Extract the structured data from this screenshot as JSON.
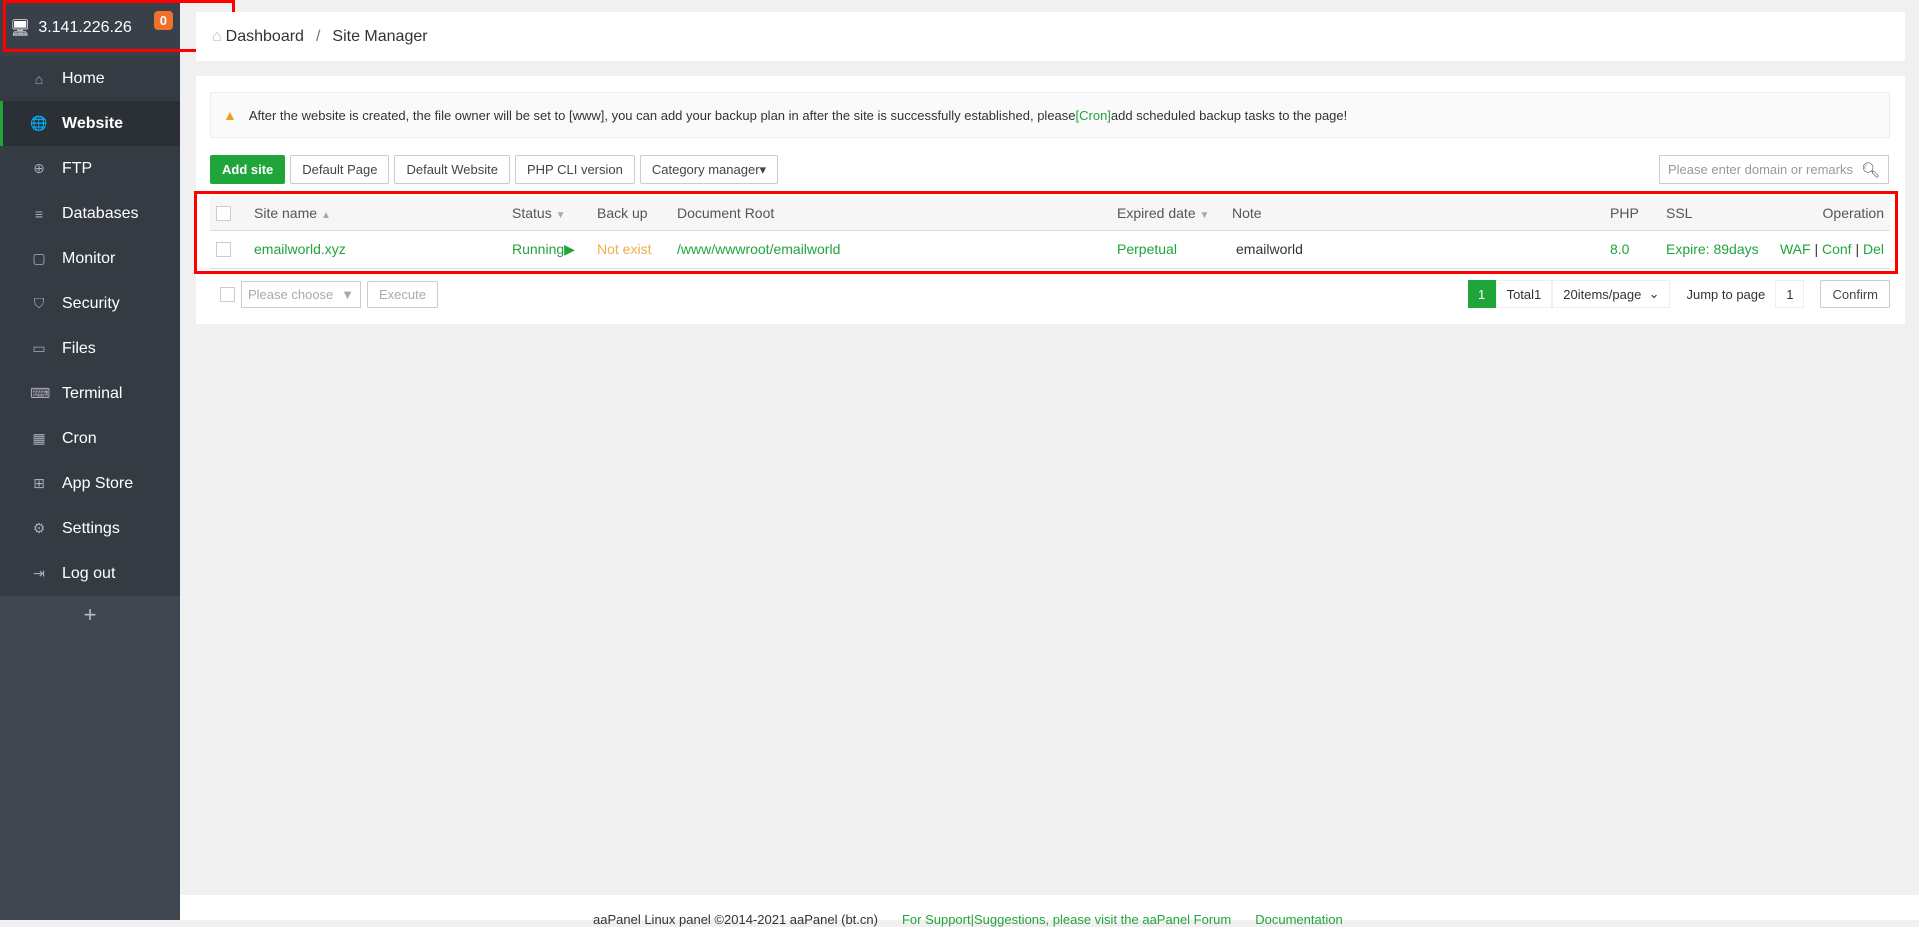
{
  "sidebar": {
    "ip": "3.141.226.26",
    "badge": "0",
    "items": [
      {
        "label": "Home",
        "icon": "⌂"
      },
      {
        "label": "Website",
        "icon": "🌐"
      },
      {
        "label": "FTP",
        "icon": "⊕"
      },
      {
        "label": "Databases",
        "icon": "≡"
      },
      {
        "label": "Monitor",
        "icon": "▢"
      },
      {
        "label": "Security",
        "icon": "⛉"
      },
      {
        "label": "Files",
        "icon": "▭"
      },
      {
        "label": "Terminal",
        "icon": "⌨"
      },
      {
        "label": "Cron",
        "icon": "▦"
      },
      {
        "label": "App Store",
        "icon": "⊞"
      },
      {
        "label": "Settings",
        "icon": "⚙"
      },
      {
        "label": "Log out",
        "icon": "⇥"
      }
    ],
    "plus": "+"
  },
  "breadcrumb": {
    "home": "Dashboard",
    "sep": "/",
    "current": "Site Manager"
  },
  "alert": {
    "before": "After the website is created, the file owner will be set to [www], you can add your backup plan in after the site is successfully established, please",
    "link": "[Cron]",
    "after": "add scheduled backup tasks to the page!"
  },
  "toolbar": {
    "add": "Add site",
    "default_page": "Default Page",
    "default_website": "Default Website",
    "php_cli": "PHP CLI version",
    "category": "Category manager▾",
    "search_placeholder": "Please enter domain or remarks"
  },
  "table": {
    "headers": {
      "site": "Site name",
      "status": "Status",
      "backup": "Back up",
      "root": "Document Root",
      "expired": "Expired date",
      "note": "Note",
      "php": "PHP",
      "ssl": "SSL",
      "op": "Operation"
    },
    "rows": [
      {
        "site": "emailworld.xyz",
        "status": "Running",
        "backup": "Not exist",
        "root": "/www/wwwroot/emailworld",
        "expired": "Perpetual",
        "note": "emailworld",
        "php": "8.0",
        "ssl": "Expire: 89days",
        "waf": "WAF",
        "conf": "Conf",
        "del": "Del"
      }
    ]
  },
  "pager": {
    "choose": "Please choose",
    "execute": "Execute",
    "page": "1",
    "total": "Total1",
    "per_page": "20items/page",
    "jump": "Jump to page",
    "jump_value": "1",
    "confirm": "Confirm"
  },
  "footer": {
    "copyright": "aaPanel Linux panel ©2014-2021 aaPanel (bt.cn)",
    "support": "For Support|Suggestions, please visit the aaPanel Forum",
    "docs": "Documentation"
  }
}
